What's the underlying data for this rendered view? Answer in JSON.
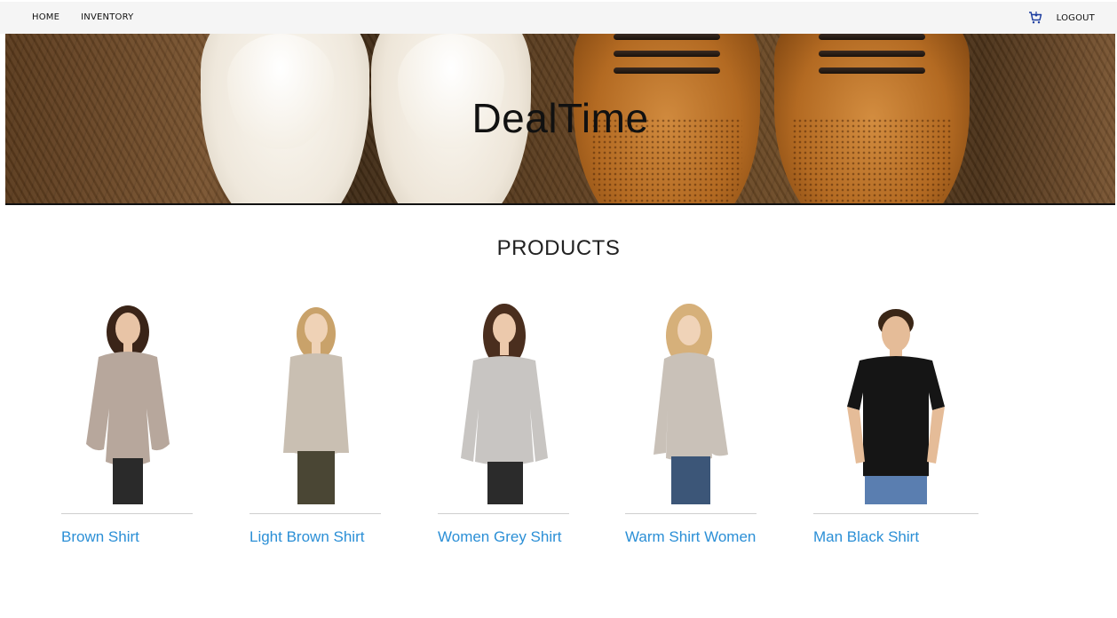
{
  "navbar": {
    "home_label": "HOME",
    "inventory_label": "INVENTORY",
    "logout_label": "LOGOUT"
  },
  "banner": {
    "title": "DealTime"
  },
  "products": {
    "heading": "PRODUCTS",
    "items": [
      {
        "name": "Brown Shirt",
        "top_color": "#b7a79c",
        "bottom_color": "#2a2a2a",
        "hair_color": "#3a2418"
      },
      {
        "name": "Light Brown Shirt",
        "top_color": "#c9bfb2",
        "bottom_color": "#4a4634",
        "hair_color": "#c9a26a"
      },
      {
        "name": "Women Grey Shirt",
        "top_color": "#c8c5c2",
        "bottom_color": "#2b2b2b",
        "hair_color": "#4a2e1e"
      },
      {
        "name": "Warm Shirt Women",
        "top_color": "#c9c1b8",
        "bottom_color": "#3c5678",
        "hair_color": "#d6b07a"
      },
      {
        "name": "Man Black Shirt",
        "top_color": "#151515",
        "bottom_color": "#5a7eb0",
        "hair_color": "#3a2616"
      }
    ]
  },
  "colors": {
    "link": "#2b8fd6",
    "navbar_bg": "#f5f5f5"
  }
}
